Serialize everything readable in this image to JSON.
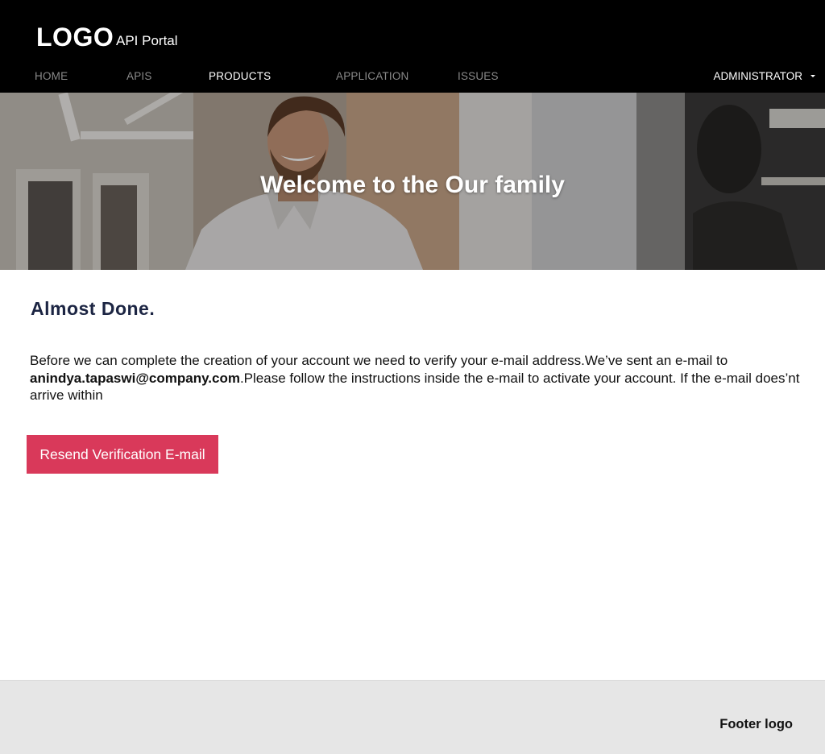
{
  "header": {
    "logo": "LOGO",
    "portal_name": "API Portal",
    "nav": {
      "home": "HOME",
      "apis": "APIS",
      "products": "PRODUCTS",
      "application": "APPLICATION",
      "issues": "ISSUES"
    },
    "active_item": "PRODUCTS",
    "user_menu": "ADMINISTRATOR",
    "user_menu_icon": "caret-down-icon"
  },
  "hero": {
    "title": "Welcome to the Our family"
  },
  "content": {
    "heading": "Almost Done.",
    "message_part1": "Before we can complete the creation of your account we need to verify your e-mail address.We’ve sent an e-mail to ",
    "email": "anindya.tapaswi@company.com",
    "message_part2": ".Please follow the instructions inside the e-mail to activate your account. If the e-mail does’nt arrive within",
    "resend_button": "Resend Verification E-mail"
  },
  "footer": {
    "logo": "Footer logo"
  },
  "colors": {
    "header_bg": "#000000",
    "heading": "#1c2543",
    "button_bg": "#d9395a",
    "footer_bg": "#e6e6e6"
  }
}
